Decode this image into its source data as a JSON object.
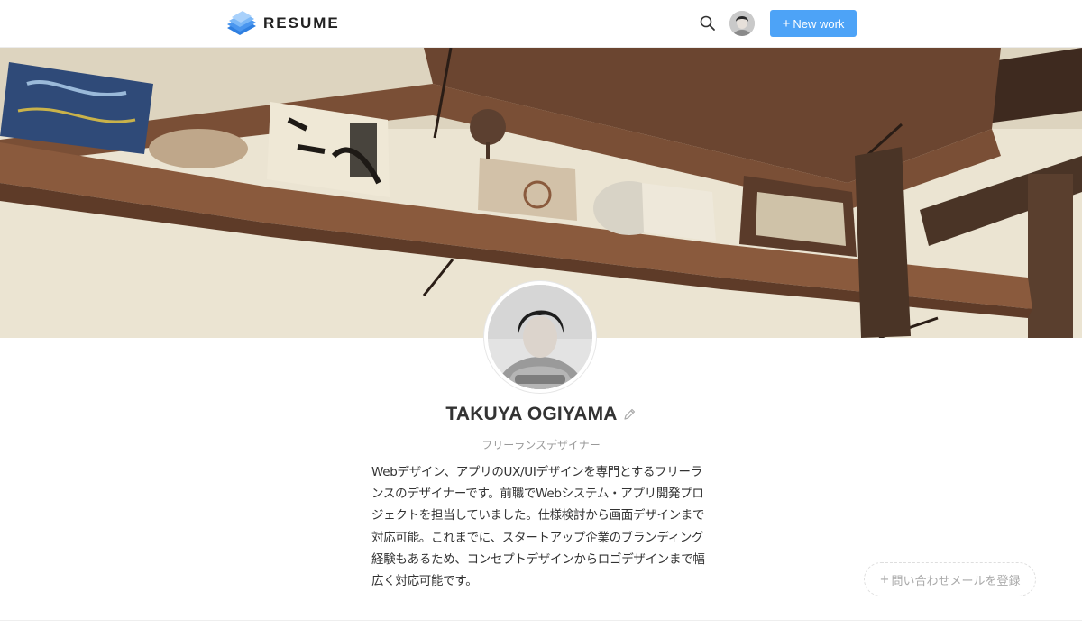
{
  "header": {
    "brand": "RESUME",
    "search_icon": "search-icon",
    "new_work_plus": "+",
    "new_work_label": "New work",
    "accent_color": "#4da3f7"
  },
  "profile": {
    "name": "TAKUYA OGIYAMA",
    "role": "フリーランスデザイナー",
    "bio": "Webデザイン、アプリのUX/UIデザインを専門とするフリーランスのデザイナーです。前職でWebシステム・アプリ開発プロジェクトを担当していました。仕様検討から画面デザインまで対応可能。これまでに、スタートアップ企業のブランディング経験もあるため、コンセプトデザインからロゴデザインまで幅広く対応可能です。",
    "edit_icon": "pencil-icon"
  },
  "contact": {
    "plus": "+",
    "label": "問い合わせメールを登録"
  }
}
